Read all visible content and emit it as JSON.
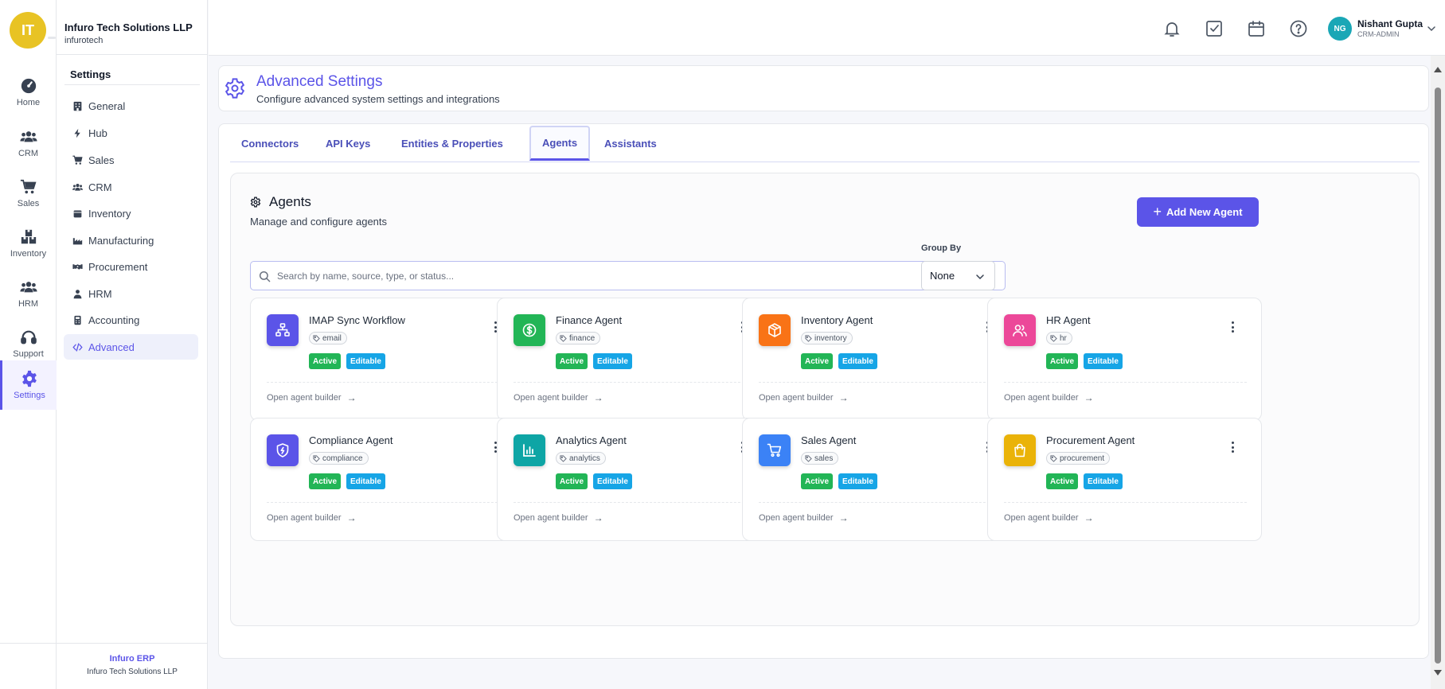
{
  "company": {
    "logo_initials": "IT",
    "name": "Infuro Tech Solutions LLP",
    "slug": "infurotech"
  },
  "rail": {
    "items": [
      {
        "label": "Home",
        "icon": "dashboard-icon"
      },
      {
        "label": "CRM",
        "icon": "users-icon"
      },
      {
        "label": "Sales",
        "icon": "cart-icon"
      },
      {
        "label": "Inventory",
        "icon": "boxes-icon"
      },
      {
        "label": "HRM",
        "icon": "users-icon"
      },
      {
        "label": "Support",
        "icon": "headset-icon"
      },
      {
        "label": "Settings",
        "icon": "gear-icon",
        "active": true
      }
    ]
  },
  "sidebar": {
    "heading": "Settings",
    "items": [
      {
        "label": "General",
        "icon": "building-icon"
      },
      {
        "label": "Hub",
        "icon": "bolt-icon"
      },
      {
        "label": "Sales",
        "icon": "cart-icon"
      },
      {
        "label": "CRM",
        "icon": "users-icon"
      },
      {
        "label": "Inventory",
        "icon": "box-icon"
      },
      {
        "label": "Manufacturing",
        "icon": "factory-icon"
      },
      {
        "label": "Procurement",
        "icon": "handshake-icon"
      },
      {
        "label": "HRM",
        "icon": "user-icon"
      },
      {
        "label": "Accounting",
        "icon": "calculator-icon"
      },
      {
        "label": "Advanced",
        "icon": "code-icon",
        "active": true
      }
    ],
    "footer_brand": "Infuro ERP",
    "footer_company": "Infuro Tech Solutions LLP"
  },
  "header": {
    "icons": [
      "bell-icon",
      "checkbox-icon",
      "calendar-icon",
      "help-icon"
    ],
    "user": {
      "initials": "NG",
      "name": "Nishant Gupta",
      "role": "CRM-ADMIN"
    }
  },
  "page": {
    "title": "Advanced Settings",
    "subtitle": "Configure advanced system settings and integrations"
  },
  "tabs": [
    {
      "label": "Connectors"
    },
    {
      "label": "API Keys"
    },
    {
      "label": "Entities & Properties"
    },
    {
      "label": "Agents",
      "active": true
    },
    {
      "label": "Assistants"
    }
  ],
  "agents_section": {
    "title": "Agents",
    "subtitle": "Manage and configure agents",
    "add_button": "Add New Agent",
    "search_placeholder": "Search by name, source, type, or status...",
    "group_by_label": "Group By",
    "group_by_value": "None",
    "status_label": "Active",
    "editable_label": "Editable",
    "open_link": "Open agent builder",
    "cards": [
      {
        "name": "IMAP Sync Workflow",
        "tag": "email",
        "icon": "sitemap-icon",
        "color": "#5b54e8"
      },
      {
        "name": "Finance Agent",
        "tag": "finance",
        "icon": "dollar-icon",
        "color": "#22b556"
      },
      {
        "name": "Inventory Agent",
        "tag": "inventory",
        "icon": "package-icon",
        "color": "#f97316"
      },
      {
        "name": "HR Agent",
        "tag": "hr",
        "icon": "user-group-icon",
        "color": "#ec4899"
      },
      {
        "name": "Compliance Agent",
        "tag": "compliance",
        "icon": "shield-icon",
        "color": "#5b54e8"
      },
      {
        "name": "Analytics Agent",
        "tag": "analytics",
        "icon": "bar-chart-icon",
        "color": "#0ea5a5"
      },
      {
        "name": "Sales Agent",
        "tag": "sales",
        "icon": "cart-icon",
        "color": "#3b82f6"
      },
      {
        "name": "Procurement Agent",
        "tag": "procurement",
        "icon": "shopping-bag-icon",
        "color": "#eab308"
      }
    ]
  }
}
